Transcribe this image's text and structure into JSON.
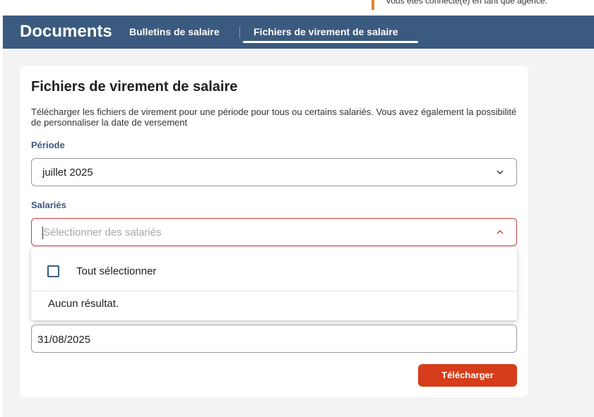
{
  "top_notice": {
    "text": "Vous êtes connecté(e) en tant que agence."
  },
  "header": {
    "title": "Documents",
    "tabs": [
      {
        "label": "Bulletins de salaire",
        "active": false
      },
      {
        "label": "Fichiers de virement de salaire",
        "active": true
      }
    ]
  },
  "card": {
    "title": "Fichiers de virement de salaire",
    "description": "Télécharger les fichiers de virement pour une période pour tous ou certains salariés. Vous avez également la possibilité de personnaliser la date de versement",
    "periode": {
      "label": "Période",
      "value": "juillet 2025",
      "icon": "chevron-down-icon"
    },
    "salaries": {
      "label": "Salariés",
      "placeholder": "Sélectionner des salariés",
      "icon": "chevron-up-icon",
      "dropdown": {
        "select_all_label": "Tout sélectionner",
        "no_result": "Aucun résultat."
      }
    },
    "date_versement": {
      "value": "31/08/2025"
    },
    "download_label": "Télécharger"
  },
  "colors": {
    "header_bg": "#3b5a80",
    "accent_orange": "#e0832a",
    "button_bg": "#d63d1a",
    "error_border": "#d23a3a"
  }
}
